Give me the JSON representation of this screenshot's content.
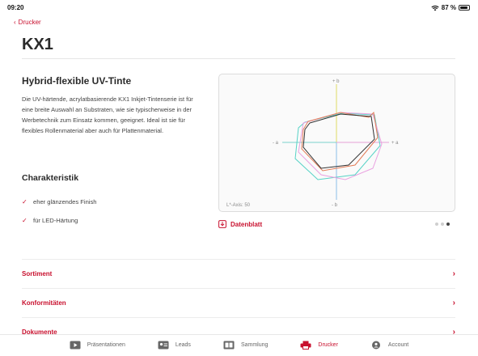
{
  "status": {
    "time": "09:20",
    "battery": "87 %",
    "battery_level": 0.87
  },
  "nav": {
    "back_label": "Drucker"
  },
  "page": {
    "title": "KX1"
  },
  "product": {
    "heading": "Hybrid-flexible UV-Tinte",
    "description": "Die UV-härtende, acrylatbasierende KX1 Inkjet-Tintenserie ist für eine breite Auswahl an Substraten, wie sie typischerweise in der Werbetechnik zum Einsatz kommen, geeignet. Ideal ist sie für flexibles Rollenmaterial aber auch für Plattenmaterial.",
    "characteristics_title": "Charakteristik",
    "characteristics": [
      "eher glänzendes Finish",
      "für LED-Härtung"
    ]
  },
  "gamut_chart": {
    "axis_plus_b": "+ b",
    "axis_minus_b": "- b",
    "axis_plus_a": "+ a",
    "axis_minus_a": "- a",
    "lightness_label": "L*-Axis: 50"
  },
  "datasheet_label": "Datenblatt",
  "carousel": {
    "count": 3,
    "active_index": 2
  },
  "rows": [
    "Sortiment",
    "Konformitäten",
    "Dokumente"
  ],
  "tabs": [
    {
      "label": "Präsentationen",
      "icon": "presentation-icon",
      "active": false
    },
    {
      "label": "Leads",
      "icon": "id-card-icon",
      "active": false
    },
    {
      "label": "Sammlung",
      "icon": "collection-icon",
      "active": false
    },
    {
      "label": "Drucker",
      "icon": "printer-icon",
      "active": true
    },
    {
      "label": "Account",
      "icon": "account-icon",
      "active": false
    }
  ],
  "colors": {
    "accent": "#c8102e",
    "text": "#2b2b2b"
  }
}
